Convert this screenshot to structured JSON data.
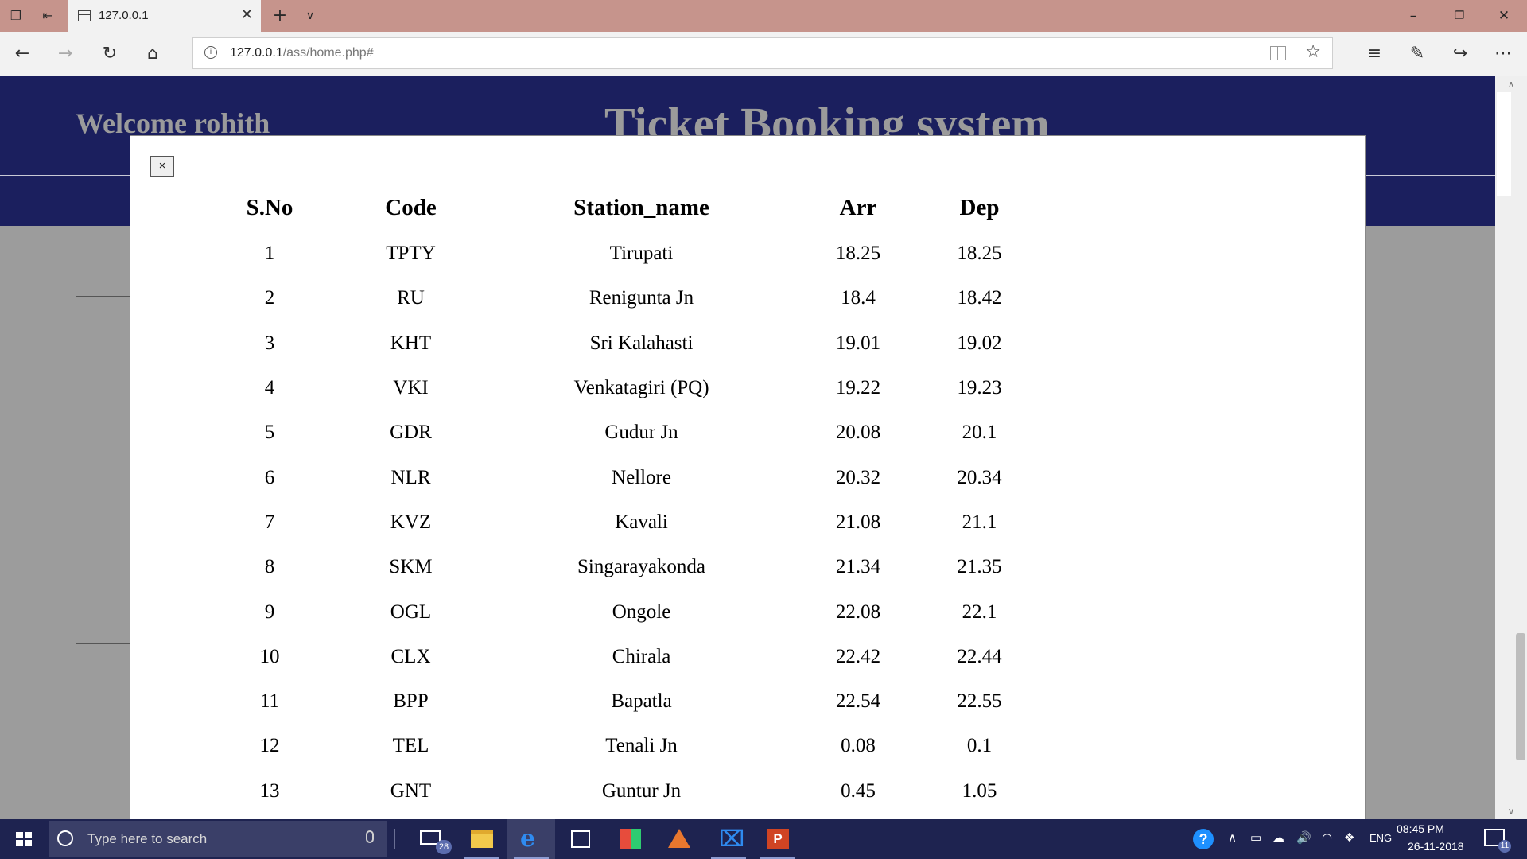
{
  "browser": {
    "tab_title": "127.0.0.1",
    "url_host": "127.0.0.1",
    "url_path": "/ass/home.php#"
  },
  "page": {
    "welcome_text": "Welcome rohith",
    "site_title": "Ticket Booking system"
  },
  "modal": {
    "close_label": "×",
    "table": {
      "headers": [
        "S.No",
        "Code",
        "Station_name",
        "Arr",
        "Dep"
      ],
      "rows": [
        [
          "1",
          "TPTY",
          "Tirupati",
          "18.25",
          "18.25"
        ],
        [
          "2",
          "RU",
          "Renigunta Jn",
          "18.4",
          "18.42"
        ],
        [
          "3",
          "KHT",
          "Sri Kalahasti",
          "19.01",
          "19.02"
        ],
        [
          "4",
          "VKI",
          "Venkatagiri (PQ)",
          "19.22",
          "19.23"
        ],
        [
          "5",
          "GDR",
          "Gudur Jn",
          "20.08",
          "20.1"
        ],
        [
          "6",
          "NLR",
          "Nellore",
          "20.32",
          "20.34"
        ],
        [
          "7",
          "KVZ",
          "Kavali",
          "21.08",
          "21.1"
        ],
        [
          "8",
          "SKM",
          "Singarayakonda",
          "21.34",
          "21.35"
        ],
        [
          "9",
          "OGL",
          "Ongole",
          "22.08",
          "22.1"
        ],
        [
          "10",
          "CLX",
          "Chirala",
          "22.42",
          "22.44"
        ],
        [
          "11",
          "BPP",
          "Bapatla",
          "22.54",
          "22.55"
        ],
        [
          "12",
          "TEL",
          "Tenali Jn",
          "0.08",
          "0.1"
        ],
        [
          "13",
          "GNT",
          "Guntur Jn",
          "0.45",
          "1.05"
        ]
      ]
    }
  },
  "taskbar": {
    "search_placeholder": "Type here to search",
    "mail_badge": "28",
    "language": "ENG",
    "time": "08:45 PM",
    "date": "26-11-2018",
    "notification_count": "11"
  },
  "colors": {
    "header_band": "#1b1f5e",
    "titlebar": "#c6948c",
    "taskbar": "#1e2350",
    "overlay": "#9c9c9c"
  }
}
